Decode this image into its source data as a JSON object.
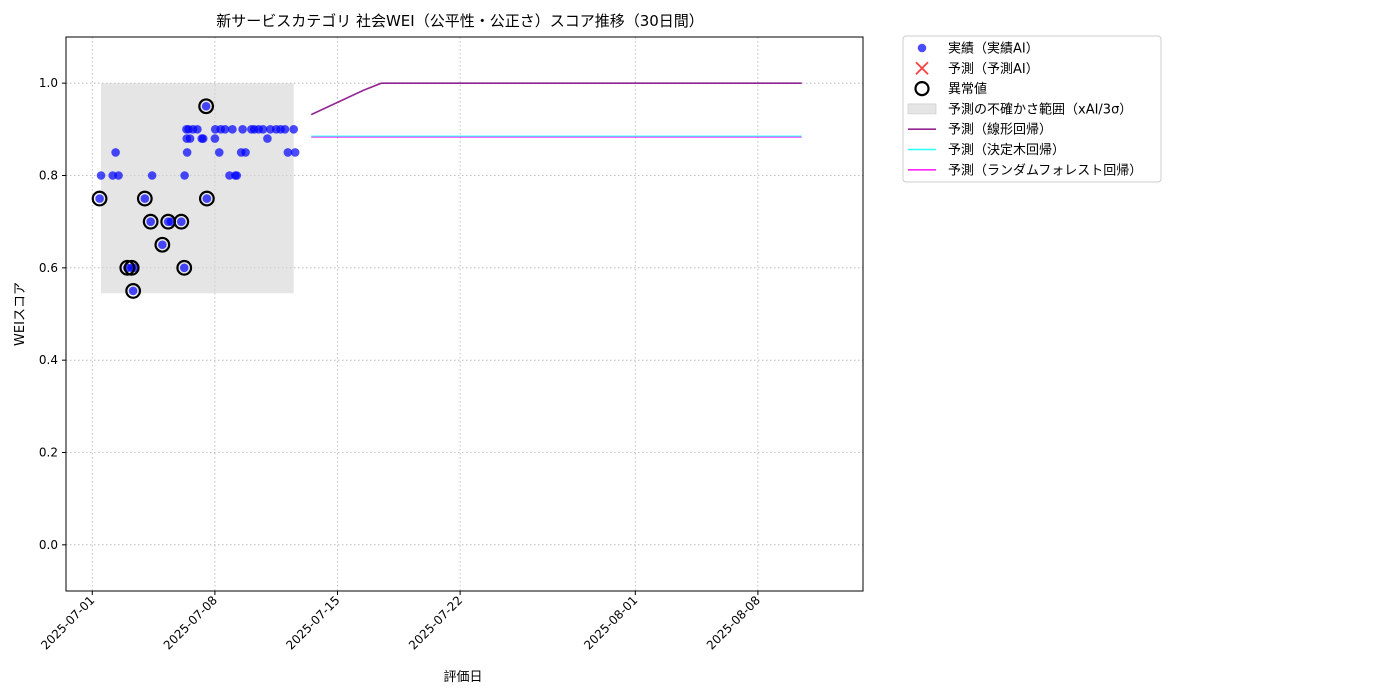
{
  "chart_data": {
    "type": "scatter",
    "title": "新サービスカテゴリ 社会WEI（公平性・公正さ）スコア推移（30日間）",
    "xlabel": "評価日",
    "ylabel": "WEIスコア",
    "xlim": [
      "2025-06-29 12:00",
      "2025-08-14 00:00"
    ],
    "ylim": [
      -0.1,
      1.1
    ],
    "y_ticks": [
      "0.0",
      "0.2",
      "0.4",
      "0.6",
      "0.8",
      "1.0"
    ],
    "x_ticks": [
      "2025-07-01",
      "2025-07-08",
      "2025-07-15",
      "2025-07-22",
      "2025-08-01",
      "2025-08-08"
    ],
    "grid": true,
    "legend_position": "outside-upper-right",
    "legend": [
      {
        "key": "actual",
        "label": "実績（実績AI）"
      },
      {
        "key": "predicted",
        "label": "予測（予測AI）"
      },
      {
        "key": "anomaly",
        "label": "異常値"
      },
      {
        "key": "band",
        "label": "予測の不確かさ範囲（xAI/3σ）"
      },
      {
        "key": "linear",
        "label": "予測（線形回帰）"
      },
      {
        "key": "tree",
        "label": "予測（決定木回帰）"
      },
      {
        "key": "forest",
        "label": "予測（ランダムフォレスト回帰）"
      }
    ],
    "colors": {
      "actual": "#0000ff",
      "predicted": "#ff0000",
      "anomaly": "#000000",
      "band": "#d3d3d3",
      "linear": "#800080",
      "tree": "#00ffff",
      "forest": "#ff00ff"
    },
    "uncertainty_band": {
      "x_start": "2025-07-01 12:00",
      "x_end": "2025-07-12 12:00",
      "y_low": 0.545,
      "y_high": 1.0
    },
    "actual_points": [
      [
        "2025-07-01 10:00",
        0.75
      ],
      [
        "2025-07-01 12:00",
        0.8
      ],
      [
        "2025-07-02 04:00",
        0.8
      ],
      [
        "2025-07-02 08:00",
        0.85
      ],
      [
        "2025-07-02 12:00",
        0.8
      ],
      [
        "2025-07-03 00:00",
        0.6
      ],
      [
        "2025-07-03 06:00",
        0.6
      ],
      [
        "2025-07-03 08:00",
        0.55
      ],
      [
        "2025-07-03 10:00",
        0.6
      ],
      [
        "2025-07-04 00:00",
        0.75
      ],
      [
        "2025-07-04 08:00",
        0.7
      ],
      [
        "2025-07-04 10:00",
        0.8
      ],
      [
        "2025-07-05 00:00",
        0.65
      ],
      [
        "2025-07-05 08:00",
        0.7
      ],
      [
        "2025-07-05 12:00",
        0.7
      ],
      [
        "2025-07-06 02:00",
        0.7
      ],
      [
        "2025-07-06 06:00",
        0.6
      ],
      [
        "2025-07-06 06:30",
        0.8
      ],
      [
        "2025-07-06 09:00",
        0.9
      ],
      [
        "2025-07-06 09:30",
        0.88
      ],
      [
        "2025-07-06 10:00",
        0.85
      ],
      [
        "2025-07-06 12:00",
        0.9
      ],
      [
        "2025-07-06 14:00",
        0.88
      ],
      [
        "2025-07-06 18:00",
        0.9
      ],
      [
        "2025-07-07 00:00",
        0.9
      ],
      [
        "2025-07-07 06:00",
        0.88
      ],
      [
        "2025-07-07 08:00",
        0.88
      ],
      [
        "2025-07-07 12:00",
        0.95
      ],
      [
        "2025-07-07 13:00",
        0.75
      ],
      [
        "2025-07-08 00:00",
        0.88
      ],
      [
        "2025-07-08 00:30",
        0.9
      ],
      [
        "2025-07-08 06:00",
        0.85
      ],
      [
        "2025-07-08 08:00",
        0.9
      ],
      [
        "2025-07-08 14:00",
        0.9
      ],
      [
        "2025-07-08 20:00",
        0.8
      ],
      [
        "2025-07-09 00:00",
        0.9
      ],
      [
        "2025-07-09 04:00",
        0.8
      ],
      [
        "2025-07-09 06:00",
        0.8
      ],
      [
        "2025-07-09 12:00",
        0.85
      ],
      [
        "2025-07-09 14:00",
        0.9
      ],
      [
        "2025-07-09 18:00",
        0.85
      ],
      [
        "2025-07-10 02:00",
        0.9
      ],
      [
        "2025-07-10 06:00",
        0.9
      ],
      [
        "2025-07-10 12:00",
        0.9
      ],
      [
        "2025-07-10 18:00",
        0.9
      ],
      [
        "2025-07-11 00:00",
        0.88
      ],
      [
        "2025-07-11 04:00",
        0.9
      ],
      [
        "2025-07-11 12:00",
        0.9
      ],
      [
        "2025-07-11 18:00",
        0.9
      ],
      [
        "2025-07-12 00:00",
        0.9
      ],
      [
        "2025-07-12 04:00",
        0.85
      ],
      [
        "2025-07-12 12:00",
        0.9
      ],
      [
        "2025-07-12 14:00",
        0.85
      ]
    ],
    "anomaly_points": [
      [
        "2025-07-01 10:00",
        0.75
      ],
      [
        "2025-07-03 00:00",
        0.6
      ],
      [
        "2025-07-03 06:00",
        0.6
      ],
      [
        "2025-07-03 08:00",
        0.55
      ],
      [
        "2025-07-04 00:00",
        0.75
      ],
      [
        "2025-07-04 08:00",
        0.7
      ],
      [
        "2025-07-05 00:00",
        0.65
      ],
      [
        "2025-07-05 08:00",
        0.7
      ],
      [
        "2025-07-06 02:00",
        0.7
      ],
      [
        "2025-07-06 06:00",
        0.6
      ],
      [
        "2025-07-07 12:00",
        0.95
      ],
      [
        "2025-07-07 13:00",
        0.75
      ]
    ],
    "series": [
      {
        "key": "linear",
        "name": "予測（線形回帰）",
        "points": [
          [
            "2025-07-13 12:00",
            0.932
          ],
          [
            "2025-07-16 12:00",
            0.985
          ],
          [
            "2025-07-17 12:00",
            1.0
          ],
          [
            "2025-08-10 12:00",
            1.0
          ]
        ]
      },
      {
        "key": "tree",
        "name": "予測（決定木回帰）",
        "points": [
          [
            "2025-07-13 12:00",
            0.885
          ],
          [
            "2025-08-10 12:00",
            0.885
          ]
        ]
      },
      {
        "key": "forest",
        "name": "予測（ランダムフォレスト回帰）",
        "points": [
          [
            "2025-07-13 12:00",
            0.883
          ],
          [
            "2025-08-10 12:00",
            0.883
          ]
        ]
      }
    ]
  }
}
